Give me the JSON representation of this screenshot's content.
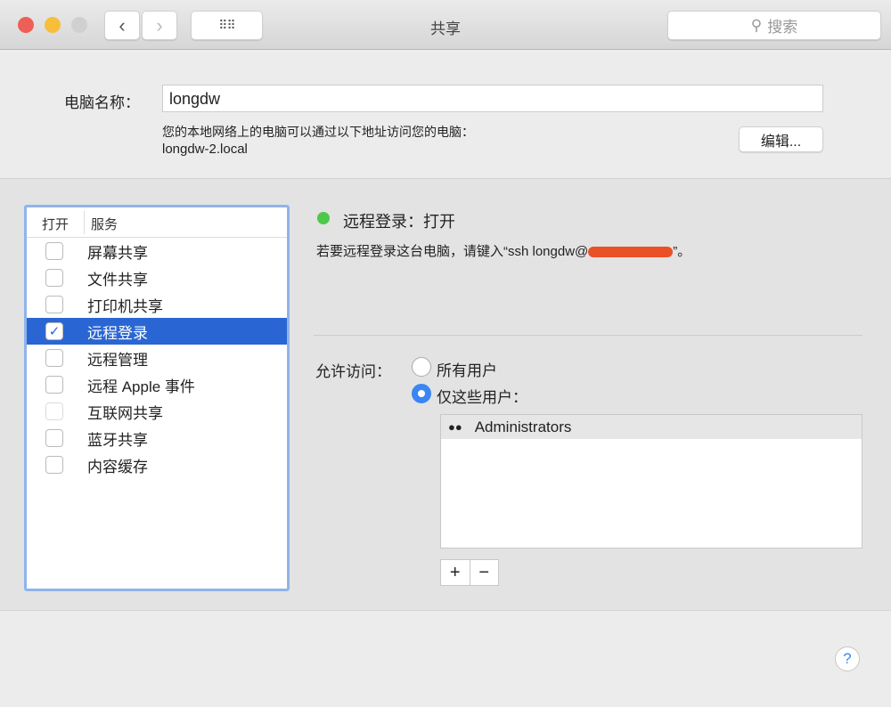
{
  "window": {
    "title": "共享",
    "search_placeholder": "搜索"
  },
  "computer": {
    "name_label": "电脑名称：",
    "name_value": "longdw",
    "address_note": "您的本地网络上的电脑可以通过以下地址访问您的电脑：",
    "local_address": "longdw-2.local",
    "edit_label": "编辑..."
  },
  "services": {
    "col_on": "打开",
    "col_service": "服务",
    "items": [
      {
        "label": "屏幕共享",
        "checked": false
      },
      {
        "label": "文件共享",
        "checked": false
      },
      {
        "label": "打印机共享",
        "checked": false
      },
      {
        "label": "远程登录",
        "checked": true,
        "selected": true
      },
      {
        "label": "远程管理",
        "checked": false
      },
      {
        "label": "远程 Apple 事件",
        "checked": false
      },
      {
        "label": "互联网共享",
        "checked": false
      },
      {
        "label": "蓝牙共享",
        "checked": false
      },
      {
        "label": "内容缓存",
        "checked": false
      }
    ]
  },
  "detail": {
    "status": "远程登录：打开",
    "status_color": "#4cc94a",
    "instruction_prefix": "若要远程登录这台电脑，请键入“ssh longdw@",
    "instruction_suffix": "”。",
    "access_label": "允许访问：",
    "opt_all": "所有用户",
    "opt_only": "仅这些用户：",
    "users": [
      "Administrators"
    ],
    "add": "+",
    "remove": "−"
  },
  "help": "?"
}
